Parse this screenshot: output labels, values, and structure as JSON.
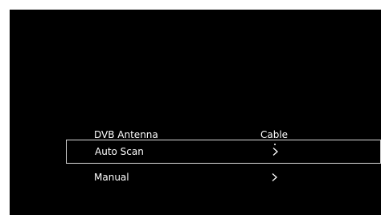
{
  "menu": {
    "items": [
      {
        "label": "DVB Antenna",
        "value": "Cable",
        "selected": false
      },
      {
        "label": "Auto Scan",
        "value_icon": "chevron-right-icon",
        "selected": true
      },
      {
        "label": "Manual",
        "value_icon": "chevron-right-icon",
        "selected": false
      }
    ]
  },
  "colors": {
    "background": "#000000",
    "text": "#ffffff",
    "selection_border": "#d8d8d8"
  }
}
